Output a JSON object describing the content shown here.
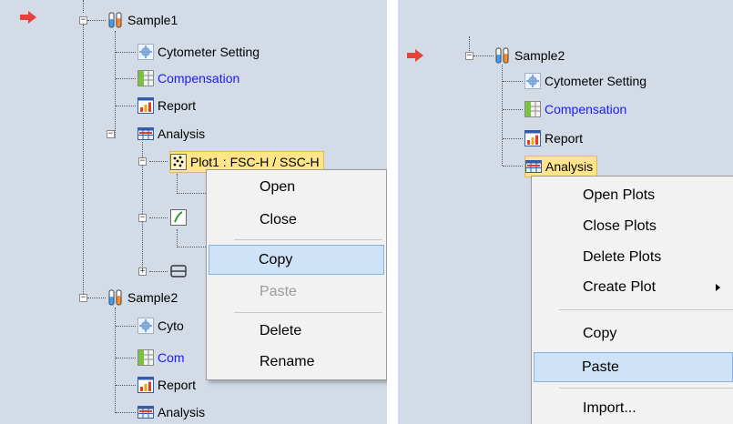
{
  "left": {
    "sample1": {
      "label": "Sample1"
    },
    "items": [
      {
        "label": "Cytometer Setting"
      },
      {
        "label": "Compensation"
      },
      {
        "label": "Report"
      },
      {
        "label": "Analysis"
      }
    ],
    "plot1": {
      "label": "Plot1 : FSC-H / SSC-H"
    },
    "sample2": {
      "label": "Sample2"
    },
    "sample2_items": [
      {
        "label": "Cyto"
      },
      {
        "label": "Com"
      },
      {
        "label": "Report"
      },
      {
        "label": "Analysis"
      }
    ],
    "context_menu": {
      "items": [
        "Open",
        "Close",
        "Copy",
        "Paste",
        "Delete",
        "Rename"
      ],
      "highlighted": "Copy",
      "disabled": "Paste"
    }
  },
  "right": {
    "sample2": {
      "label": "Sample2"
    },
    "items": [
      {
        "label": "Cytometer Setting"
      },
      {
        "label": "Compensation"
      },
      {
        "label": "Report"
      },
      {
        "label": "Analysis"
      }
    ],
    "context_menu": {
      "items": [
        "Open Plots",
        "Close Plots",
        "Delete Plots",
        "Create Plot",
        "Copy",
        "Paste",
        "Import..."
      ],
      "highlighted": "Paste",
      "submenu_item": "Create Plot"
    }
  },
  "colors": {
    "panel_bg": "#d3dbe6",
    "link_blue": "#1a1aff",
    "selection_bg": "#ffe58a",
    "menu_highlight": "#cfe3f8",
    "arrow_red": "#e8403a"
  },
  "icons": {
    "current_marker": "red-arrow-icon",
    "sample": "test-tubes-icon",
    "cytometer_setting": "gear-icon",
    "compensation": "compensation-grid-icon",
    "report": "bar-chart-icon",
    "analysis": "analysis-table-icon",
    "plot": "scatter-plot-icon",
    "histogram": "histogram-plot-icon",
    "gate": "gate-icon",
    "submenu": "chevron-right-icon"
  }
}
